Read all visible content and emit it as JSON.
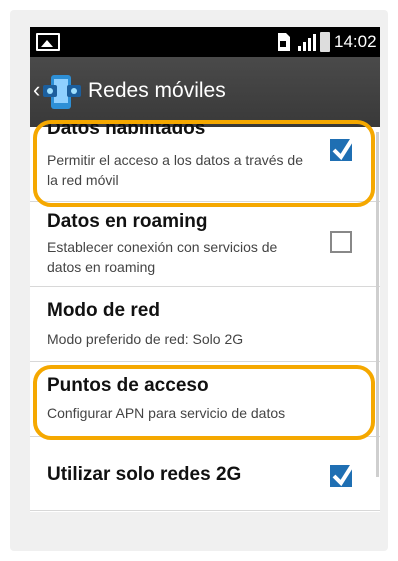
{
  "statusbar": {
    "time": "14:02",
    "sim_icon": "sim-card-icon",
    "signal_icon": "signal-icon",
    "battery_icon": "battery-icon",
    "gallery_icon": "image-icon"
  },
  "actionbar": {
    "title": "Redes móviles",
    "icon": "mobile-networks-icon",
    "back_icon": "chevron-left-icon"
  },
  "settings": [
    {
      "title": "Datos habilitados",
      "subtitle": "Permitir el acceso a los datos a través de la red móvil",
      "checkbox": true,
      "checked": true
    },
    {
      "title": "Datos en roaming",
      "subtitle": "Establecer conexión con servicios de datos en roaming",
      "checkbox": true,
      "checked": false
    },
    {
      "title": "Modo de red",
      "subtitle": "Modo preferido de red: Solo 2G",
      "checkbox": false
    },
    {
      "title": "Puntos de acceso",
      "subtitle": "Configurar APN para servicio de datos",
      "checkbox": false
    },
    {
      "title": "Utilizar solo redes 2G",
      "subtitle": "",
      "checkbox": true,
      "checked": true
    }
  ],
  "colors": {
    "highlight": "#f5a800",
    "checkbox_checked": "#1f6fb3",
    "actionbar": "#404040"
  }
}
